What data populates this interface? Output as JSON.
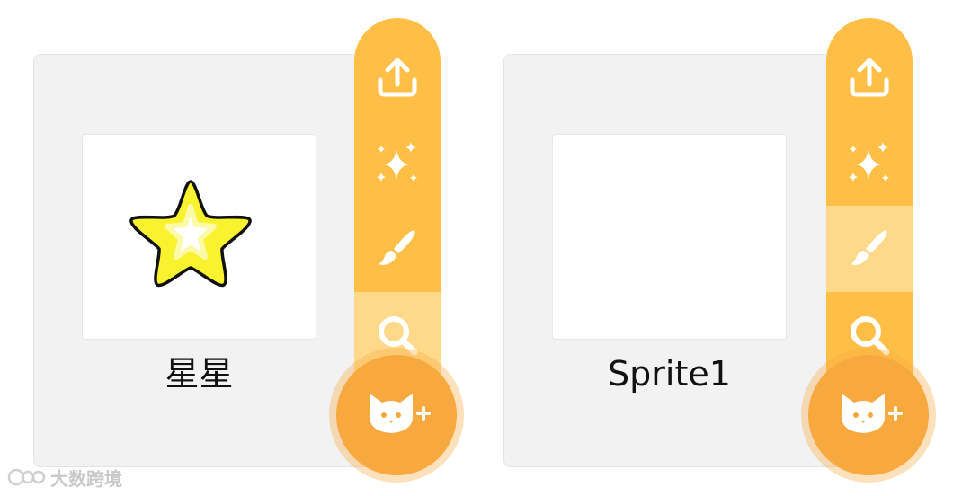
{
  "sprites": [
    {
      "name": "星星",
      "costume": "star",
      "highlighted_tool": "search"
    },
    {
      "name": "Sprite1",
      "costume": "empty",
      "highlighted_tool": "paint"
    }
  ],
  "toolbar_icons": {
    "upload": "upload-icon",
    "surprise": "sparkles-icon",
    "paint": "paintbrush-icon",
    "search": "search-icon",
    "choose": "cat-plus-icon"
  },
  "colors": {
    "toolbar": "#ffbf47",
    "toolbar_hover": "#ffd98a",
    "main_button": "#f7a83f",
    "panel": "#f2f2f2",
    "star_fill": "#f9f22f"
  },
  "watermark": {
    "text": "大数跨境"
  }
}
